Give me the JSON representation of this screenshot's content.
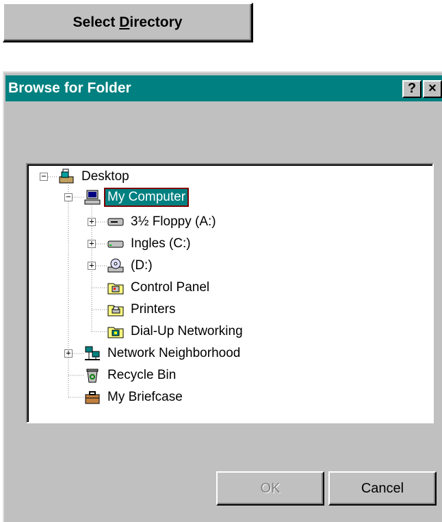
{
  "top_button": {
    "prefix": "Select ",
    "mnemonic": "D",
    "suffix": "irectory"
  },
  "dialog": {
    "title": "Browse for Folder",
    "help_glyph": "?",
    "close_glyph": "×"
  },
  "tree": {
    "items": [
      {
        "label": "Desktop",
        "icon": "desktop-icon"
      },
      {
        "label": "My Computer",
        "icon": "computer-icon",
        "selected": true
      },
      {
        "label": "3½ Floppy (A:)",
        "icon": "floppy-drive-icon"
      },
      {
        "label": "Ingles (C:)",
        "icon": "hard-drive-icon"
      },
      {
        "label": "(D:)",
        "icon": "cdrom-drive-icon"
      },
      {
        "label": "Control Panel",
        "icon": "control-panel-folder-icon"
      },
      {
        "label": "Printers",
        "icon": "printers-folder-icon"
      },
      {
        "label": "Dial-Up Networking",
        "icon": "dialup-folder-icon"
      },
      {
        "label": "Network Neighborhood",
        "icon": "network-icon"
      },
      {
        "label": "Recycle Bin",
        "icon": "recycle-bin-icon"
      },
      {
        "label": "My Briefcase",
        "icon": "briefcase-icon"
      }
    ]
  },
  "buttons": {
    "ok": "OK",
    "cancel": "Cancel"
  },
  "colors": {
    "titlebar": "#008080",
    "face": "#c0c0c0",
    "selection": "#008080"
  }
}
